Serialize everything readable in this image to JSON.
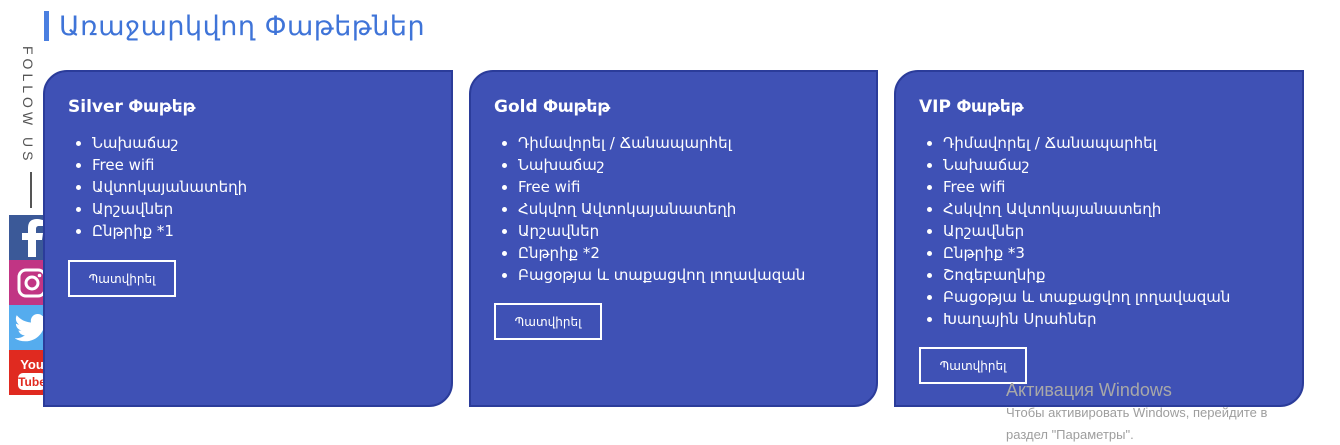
{
  "section": {
    "title": "Առաջարկվող Փաթեթներ"
  },
  "sidebar": {
    "follow_label": "FOLLOW US"
  },
  "packages": [
    {
      "title": "Silver Փաթեթ",
      "features": [
        "Նախաճաշ",
        "Free wifi",
        "Ավտոկայանատեղի",
        "Արշավներ",
        "Ընթրիք *1"
      ],
      "button": "Պատվիրել"
    },
    {
      "title": "Gold Փաթեթ",
      "features": [
        "Դիմավորել / Ճանապարհել",
        "Նախաճաշ",
        "Free wifi",
        "Հսկվող Ավտոկայանատեղի",
        "Արշավներ",
        "Ընթրիք *2",
        "Բացօթյա և տաքացվող լողավազան"
      ],
      "button": "Պատվիրել"
    },
    {
      "title": "VIP Փաթեթ",
      "features": [
        "Դիմավորել / Ճանապարհել",
        "Նախաճաշ",
        "Free wifi",
        "Հսկվող Ավտոկայանատեղի",
        "Արշավներ",
        "Ընթրիք *3",
        "Շոգեբաղնիք",
        "Բացօթյա և տաքացվող լողավազան",
        "Խաղային Սրահներ"
      ],
      "button": "Պատվիրել"
    }
  ],
  "watermark": {
    "line1": "Активация Windows",
    "line2": "Чтобы активировать Windows, перейдите в",
    "line3": "раздел \"Параметры\"."
  },
  "colors": {
    "card_bg": "#3f51b5",
    "title_accent": "#3f74d8"
  }
}
